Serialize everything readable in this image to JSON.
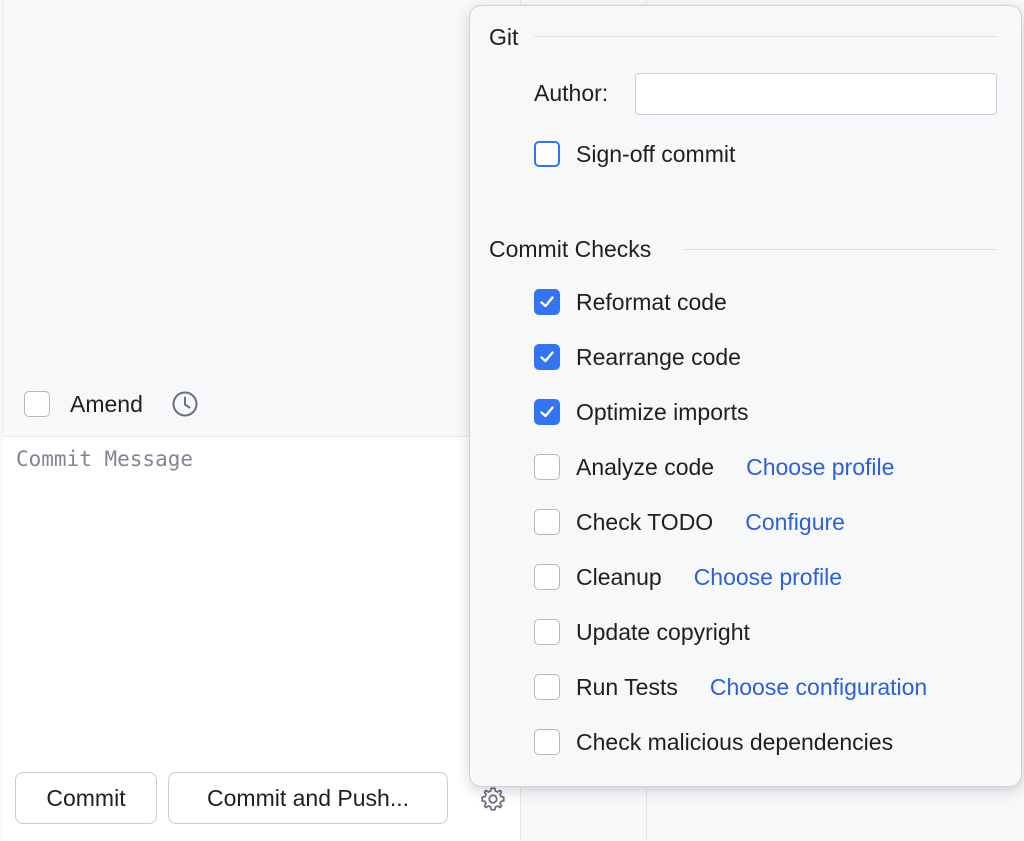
{
  "commit_panel": {
    "amend_label": "Amend",
    "message_placeholder": "Commit Message",
    "commit_button": "Commit",
    "commit_push_button": "Commit and Push..."
  },
  "popup": {
    "git_section": {
      "title": "Git",
      "author_label": "Author:",
      "author_value": "",
      "signoff_label": "Sign-off commit",
      "signoff_checked": false
    },
    "checks_section": {
      "title": "Commit Checks",
      "items": [
        {
          "label": "Reformat code",
          "checked": true,
          "link": ""
        },
        {
          "label": "Rearrange code",
          "checked": true,
          "link": ""
        },
        {
          "label": "Optimize imports",
          "checked": true,
          "link": ""
        },
        {
          "label": "Analyze code",
          "checked": false,
          "link": "Choose profile"
        },
        {
          "label": "Check TODO",
          "checked": false,
          "link": "Configure"
        },
        {
          "label": "Cleanup",
          "checked": false,
          "link": "Choose profile"
        },
        {
          "label": "Update copyright",
          "checked": false,
          "link": ""
        },
        {
          "label": "Run Tests",
          "checked": false,
          "link": "Choose configuration"
        },
        {
          "label": "Check malicious dependencies",
          "checked": false,
          "link": ""
        }
      ]
    }
  },
  "colors": {
    "accent": "#3574f0",
    "link": "#2f5fd4"
  },
  "icons": {
    "history": "history-icon",
    "settings": "gear-icon",
    "check": "checkmark-icon"
  }
}
